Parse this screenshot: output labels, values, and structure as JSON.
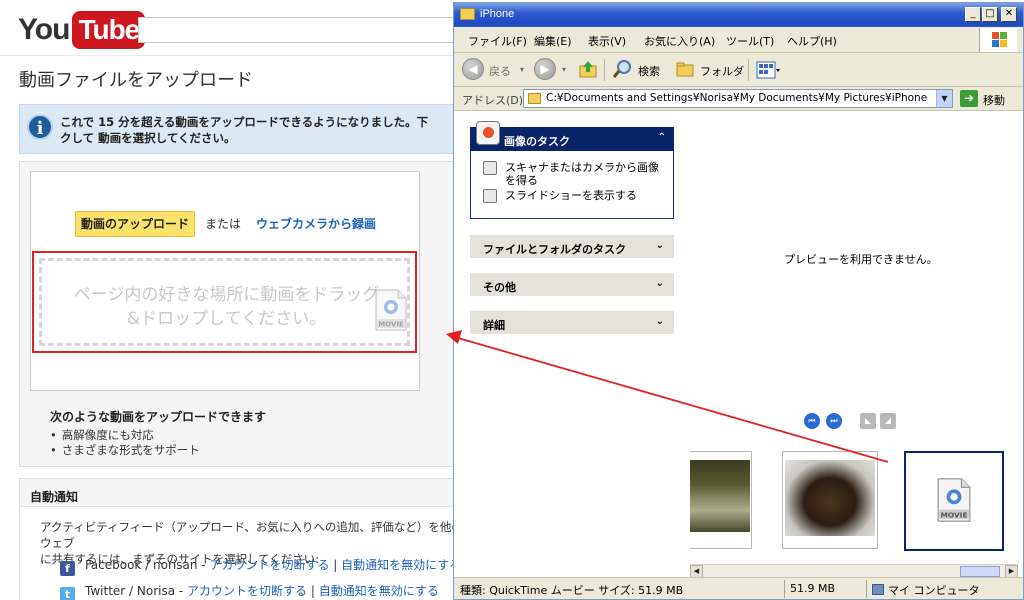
{
  "youtube": {
    "logo_you": "You",
    "logo_tube": "Tube",
    "page_title": "動画ファイルをアップロード",
    "info_line1": "これで 15 分を超える動画をアップロードできるようになりました。下",
    "info_line2": "クして 動画を選択してください。",
    "upload_button": "動画のアップロード",
    "or_text": "または",
    "webcam_link": "ウェブカメラから録画",
    "drop_line1": "ページ内の好きな場所に動画をドラッグ",
    "drop_line2": "&ドロップしてください。",
    "movie_label": "MOVIE",
    "can_upload_title": "次のような動画をアップロードできます",
    "can_upload_items": [
      "高解像度にも対応",
      "さまざまな形式をサポート"
    ],
    "notify_title": "自動通知",
    "notify_desc_line1": "アクティビティフィード（アップロード、お気に入りへの追加、評価など）を他のウェブ",
    "notify_desc_line2": "に共有するには、まずそのサイトを選択してください:",
    "facebook": {
      "icon": "f",
      "label": "Facebook / norisan - ",
      "switch": "アカウントを切断する",
      "sep": " | ",
      "disable": "自動通知を無効にする"
    },
    "twitter": {
      "icon": "t",
      "label": "Twitter / Norisa - ",
      "switch": "アカウントを切断する",
      "sep": " | ",
      "disable": "自動通知を無効にする"
    }
  },
  "explorer": {
    "title": "iPhone",
    "menu": [
      "ファイル(F)",
      "編集(E)",
      "表示(V)",
      "お気に入り(A)",
      "ツール(T)",
      "ヘルプ(H)"
    ],
    "toolbar": {
      "back": "戻る",
      "search": "検索",
      "folders": "フォルダ"
    },
    "address_label": "アドレス(D)",
    "address_path": "C:¥Documents and Settings¥Norisa¥My Documents¥My Pictures¥iPhone",
    "go_label": "移動",
    "image_tasks": {
      "title": "画像のタスク",
      "items": [
        "スキャナまたはカメラから画像を得る",
        "スライドショーを表示する"
      ]
    },
    "file_folder_tasks": "ファイルとフォルダのタスク",
    "other_places": "その他",
    "details": "詳細",
    "preview_text": "プレビューを利用できません。",
    "movie_label": "MOVIE",
    "status": {
      "type": "種類: QuickTime ムービー サイズ: 51.9 MB",
      "size": "51.9 MB",
      "location": "マイ コンピュータ"
    }
  },
  "colors": {
    "youtube_red": "#cc181e",
    "link_blue": "#1c62b9",
    "xp_blue": "#0a246a",
    "drag_arrow": "#e02222"
  }
}
